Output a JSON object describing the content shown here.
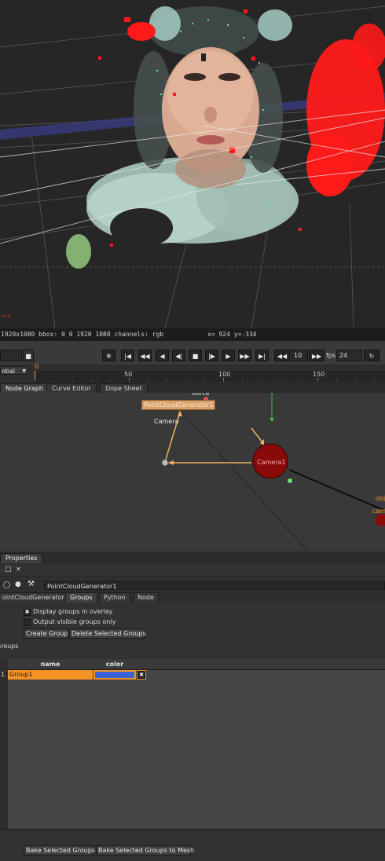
{
  "viewer": {
    "format_info": "1920x1080 bbox: 0 0 1920 1080 channels: rgb",
    "cursor_info": "x= 924 y=-334",
    "axis_label": "x"
  },
  "transport": {
    "frame_value": "",
    "increment_value": "10",
    "fps_label": "fps",
    "fps_value": "24",
    "buttons": [
      "snowflake-icon",
      "first-frame-icon",
      "prev-keyframe-icon",
      "prev-frame-icon",
      "play-backward-icon",
      "stop-icon",
      "play-forward-icon",
      "next-frame-icon",
      "next-keyframe-icon",
      "last-frame-icon"
    ]
  },
  "timeline": {
    "scope_select": "obal",
    "current_frame": "0",
    "ticks": [
      {
        "label": "0",
        "frame": 0
      },
      {
        "label": "50",
        "frame": 50
      },
      {
        "label": "100",
        "frame": 100
      },
      {
        "label": "150",
        "frame": 150
      }
    ]
  },
  "graph_tabs": [
    "Node Graph",
    "Curve Editor",
    "Dope Sheet"
  ],
  "nodegraph": {
    "source_label": "ource",
    "point_cloud_node": "PointCloudGenerator1",
    "camera_input_label": "Camera",
    "camera_node": "Camera1",
    "right_label_1": "obj",
    "right_label_2": "cam"
  },
  "properties": {
    "panel_tab": "Properties",
    "node_name": "PointCloudGenerator1",
    "tabs": [
      "ointCloudGenerator",
      "Groups",
      "Python",
      "Node"
    ],
    "active_tab": "Groups",
    "display_groups_label": "Display groups in overlay",
    "display_groups_checked": true,
    "output_visible_label": "Output visible groups only",
    "output_visible_checked": false,
    "create_group_button": "Create Group",
    "delete_groups_button": "Delete Selected Groups",
    "groups_label": "Groups",
    "table": {
      "columns": [
        "name",
        "color"
      ],
      "rows": [
        {
          "index": "1",
          "name": "Group1",
          "color": "#3b63d8",
          "visible": true
        }
      ]
    },
    "bake_groups_button": "Bake Selected Groups",
    "bake_mesh_button": "Bake Selected Groups to Mesh"
  },
  "colors": {
    "accent_orange": "#f0962c",
    "selection_orange": "#f39326",
    "group_blue": "#3b63d8",
    "camera_node_red": "#8a0a0a",
    "point_red": "#ff1a1a"
  }
}
